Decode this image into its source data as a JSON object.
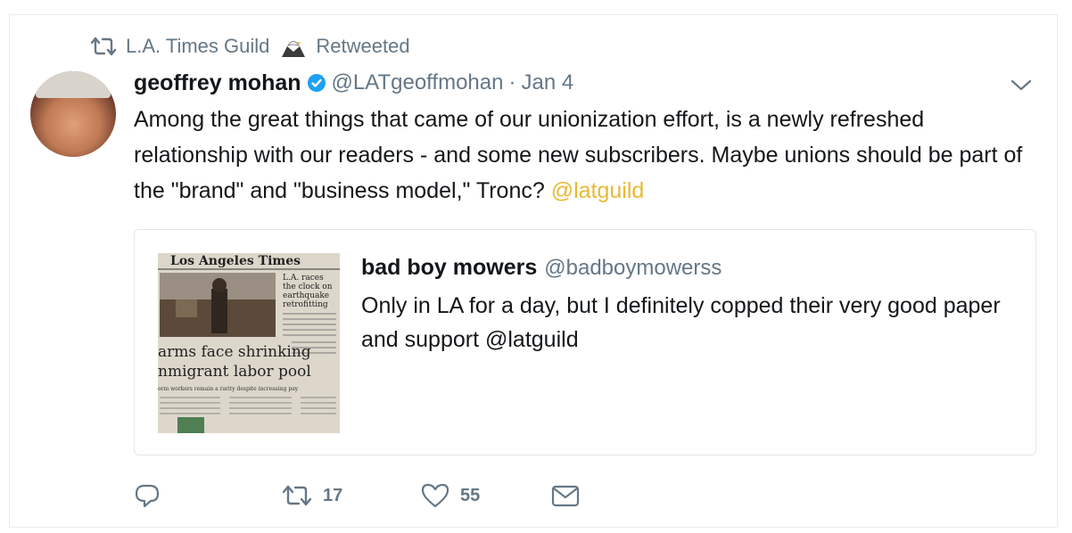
{
  "retweet_context": {
    "account": "L.A. Times Guild",
    "action": "Retweeted"
  },
  "tweet": {
    "author_name": "geoffrey mohan",
    "handle": "@LATgeoffmohan",
    "separator": "·",
    "date": "Jan 4",
    "text_main": "Among the great things that came of our unionization effort, is a newly refreshed relationship with our readers - and some new subscribers. Maybe unions should be part of the \"brand\" and \"business model,\" Tronc? ",
    "text_mention": "@latguild",
    "verified": true
  },
  "quoted_tweet": {
    "author_name": "bad boy mowers",
    "handle": "@badboymowerss",
    "text": "Only in LA for a day, but I definitely copped their very good paper and support @latguild",
    "image": {
      "masthead": "Los Angeles Times",
      "teaser_lines": [
        "L.A. races",
        "the clock on",
        "earthquake",
        "retrofitting"
      ],
      "headline_1": "arms face shrinking",
      "headline_2": "nmigrant labor pool",
      "deck": "orm workers remain a rarity despite increasing pay"
    }
  },
  "actions": {
    "reply_icon": "reply-icon",
    "retweet_count": "17",
    "like_count": "55",
    "dm_icon": "envelope-icon"
  },
  "colors": {
    "muted": "#657786",
    "mention": "#e8b935",
    "verified": "#1da1f2",
    "border": "#e1e8ed"
  }
}
